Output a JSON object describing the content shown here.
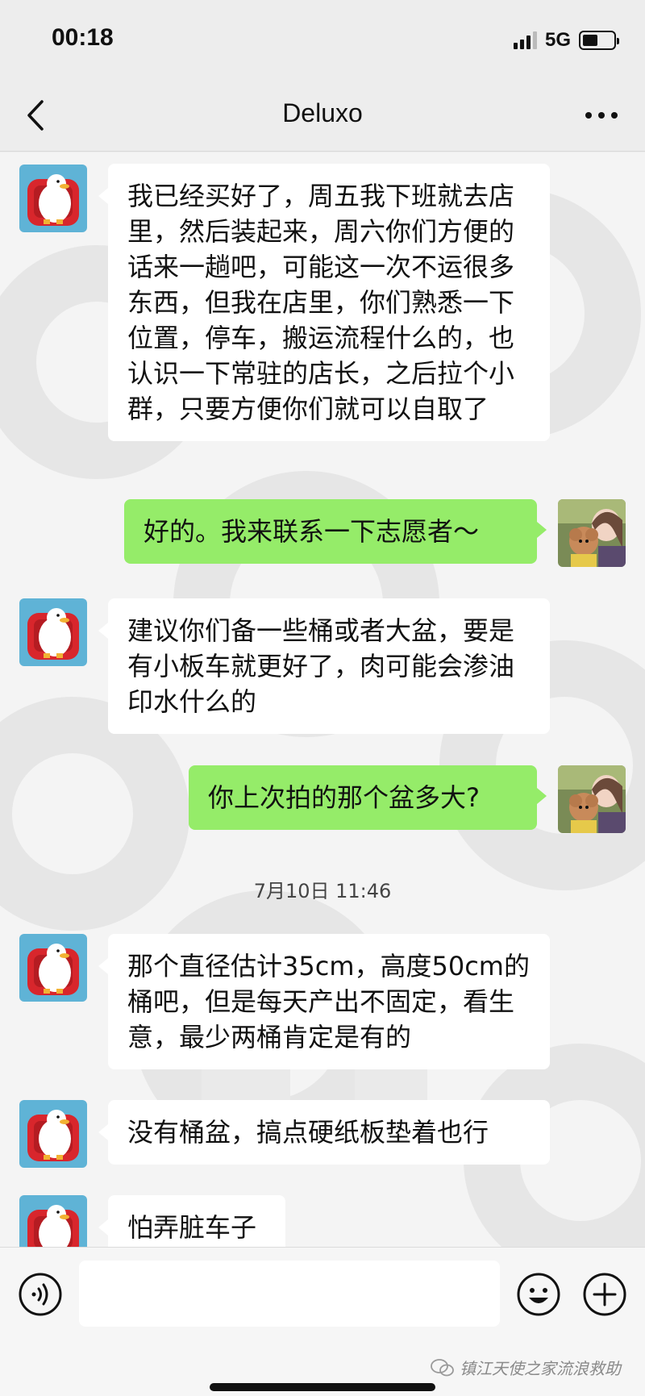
{
  "status_bar": {
    "time": "00:18",
    "network": "5G",
    "battery_level": 0.5
  },
  "nav": {
    "title": "Deluxo"
  },
  "chat": {
    "messages": [
      {
        "from": "contact",
        "text": "我已经买好了，周五我下班就去店里，然后装起来，周六你们方便的话来一趟吧，可能这一次不运很多东西，但我在店里，你们熟悉一下位置，停车，搬运流程什么的，也认识一下常驻的店长，之后拉个小群，只要方便你们就可以自取了"
      },
      {
        "from": "me",
        "text": "好的。我来联系一下志愿者～"
      },
      {
        "from": "contact",
        "text": "建议你们备一些桶或者大盆，要是有小板车就更好了，肉可能会渗油印水什么的"
      },
      {
        "from": "me",
        "text": "你上次拍的那个盆多大?"
      },
      {
        "from": "contact",
        "text": "那个直径估计35cm，高度50cm的桶吧，但是每天产出不固定，看生意，最少两桶肯定是有的"
      },
      {
        "from": "contact",
        "text": "没有桶盆，搞点硬纸板垫着也行"
      },
      {
        "from": "contact",
        "text": "怕弄脏车子"
      }
    ],
    "timestamp": "7月10日 11:46"
  },
  "input": {
    "value": ""
  },
  "credit": {
    "text": "镇江天使之家流浪救助"
  },
  "colors": {
    "outgoing_bubble": "#95ec69",
    "incoming_bubble": "#ffffff",
    "background": "#ededed"
  },
  "icons": [
    "signal-icon",
    "battery-icon",
    "back-icon",
    "more-icon",
    "voice-icon",
    "emoji-icon",
    "plus-icon",
    "wechat-icon"
  ]
}
